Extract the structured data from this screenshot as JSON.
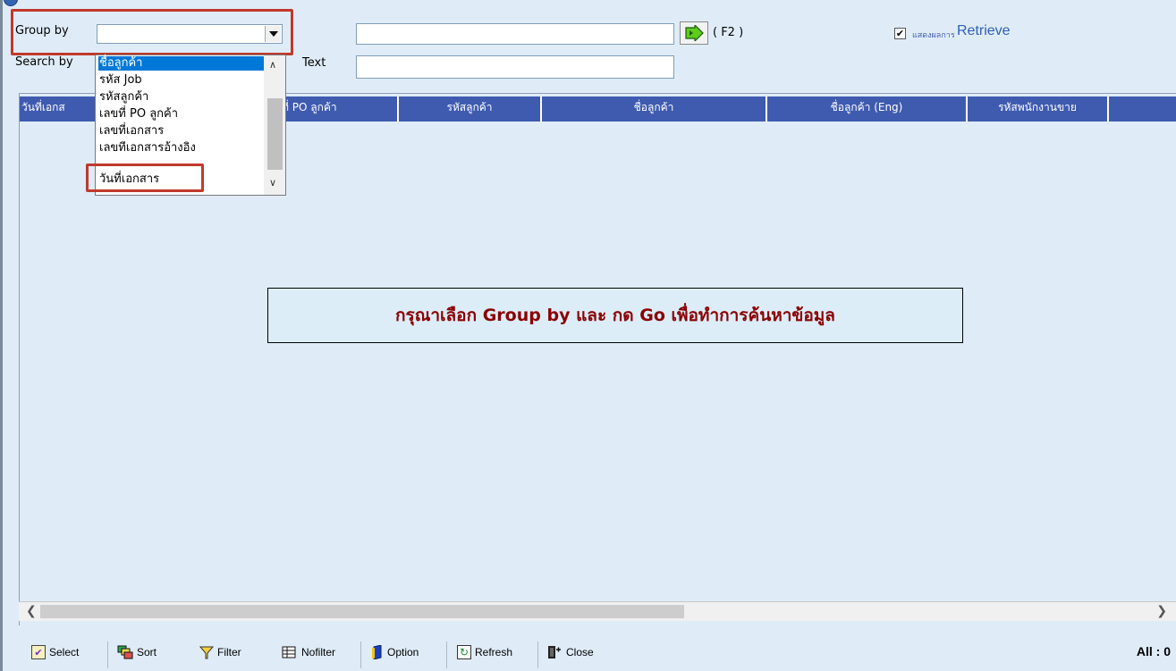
{
  "search": {
    "group_by_label": "Group by",
    "group_by_value": "",
    "search_by_label": "Search by",
    "text_label": "Text",
    "text_value": "",
    "search_value": "",
    "go_shortcut": "( F2 )",
    "retrieve_checked": true,
    "retrieve_prefix": "แสดงผลการ",
    "retrieve_label": "Retrieve"
  },
  "dropdown": {
    "items": [
      "ชื่อลูกค้า",
      "รหัส Job",
      "รหัสลูกค้า",
      "เลขที่ PO ลูกค้า",
      "เลขที่เอกสาร",
      "เลขที่เอกสารอ้างอิง",
      "วันที่เอกสาร"
    ],
    "selected_index": 0,
    "highlighted_index": 6
  },
  "grid": {
    "columns": [
      "วันที่เอกส",
      "เลขที่ PO ลูกค้า",
      "รหัสลูกค้า",
      "ชื่อลูกค้า",
      "ชื่อลูกค้า (Eng)",
      "รหัสพนักงานขาย"
    ],
    "message": "กรุณาเลือก Group  by และ กด Go เพื่อทำการค้นหาข้อมูล"
  },
  "toolbar": {
    "select": "Select",
    "sort": "Sort",
    "filter": "Filter",
    "nofilter": "Nofilter",
    "option": "Option",
    "refresh": "Refresh",
    "close": "Close",
    "count": "All : 0"
  },
  "colors": {
    "background": "#dfecf7",
    "header": "#3f5bb0",
    "message_text": "#8b0000",
    "highlight": "#c0392b",
    "selection": "#0078d7"
  }
}
